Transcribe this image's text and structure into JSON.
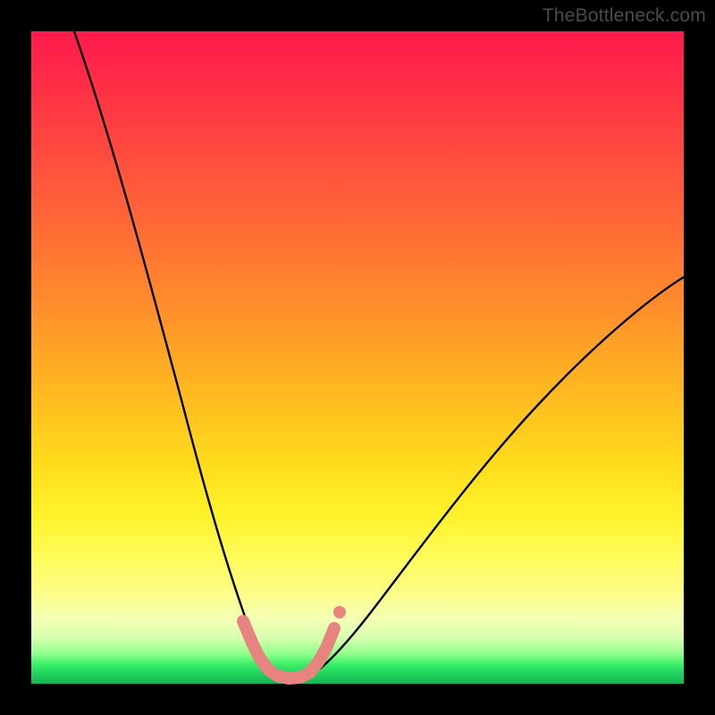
{
  "watermark": "TheBottleneck.com",
  "chart_data": {
    "type": "line",
    "title": "",
    "xlabel": "",
    "ylabel": "",
    "xlim": [
      0,
      100
    ],
    "ylim": [
      0,
      100
    ],
    "background_gradient": {
      "top": "#ff1a4d",
      "mid": "#fff22a",
      "bottom": "#17b553"
    },
    "series": [
      {
        "name": "left-curve",
        "x": [
          6,
          10,
          14,
          18,
          22,
          25,
          27,
          29,
          31,
          33,
          35
        ],
        "y": [
          100,
          82,
          63,
          46,
          30,
          18,
          11,
          6,
          3,
          1,
          0
        ]
      },
      {
        "name": "right-curve",
        "x": [
          41,
          44,
          48,
          53,
          58,
          64,
          71,
          79,
          88,
          100
        ],
        "y": [
          0,
          1,
          3,
          7,
          12,
          19,
          27,
          36,
          45,
          55
        ]
      },
      {
        "name": "residual-marks",
        "x": [
          31,
          33,
          34,
          35,
          36,
          37.5,
          39,
          40.5,
          41.5,
          43,
          45
        ],
        "y": [
          9,
          5,
          3,
          1.5,
          0.8,
          0.4,
          0.4,
          0.8,
          1.8,
          4,
          8
        ]
      }
    ]
  }
}
